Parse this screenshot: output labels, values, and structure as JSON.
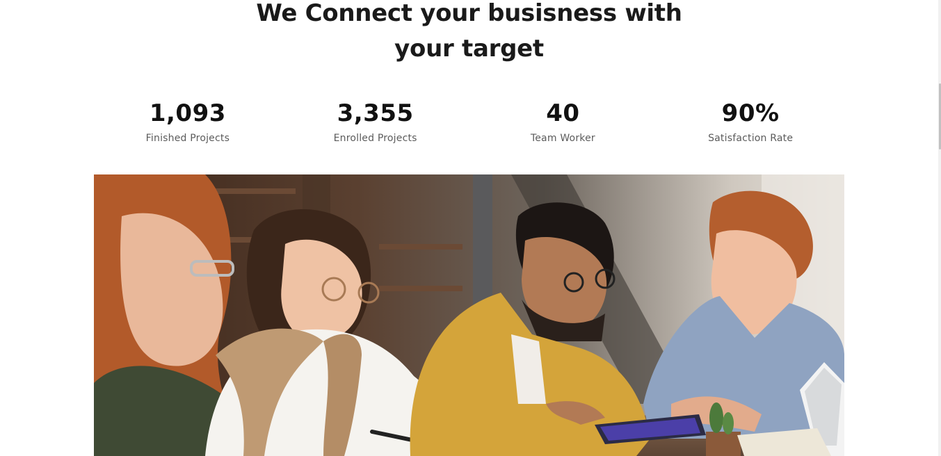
{
  "hero": {
    "title_line1": "We Connect your busisness with",
    "title_line2": "your target"
  },
  "stats": [
    {
      "value": "1,093",
      "label": "Finished Projects"
    },
    {
      "value": "3,355",
      "label": "Enrolled Projects"
    },
    {
      "value": "40",
      "label": "Team Worker"
    },
    {
      "value": "90%",
      "label": "Satisfaction Rate"
    }
  ]
}
